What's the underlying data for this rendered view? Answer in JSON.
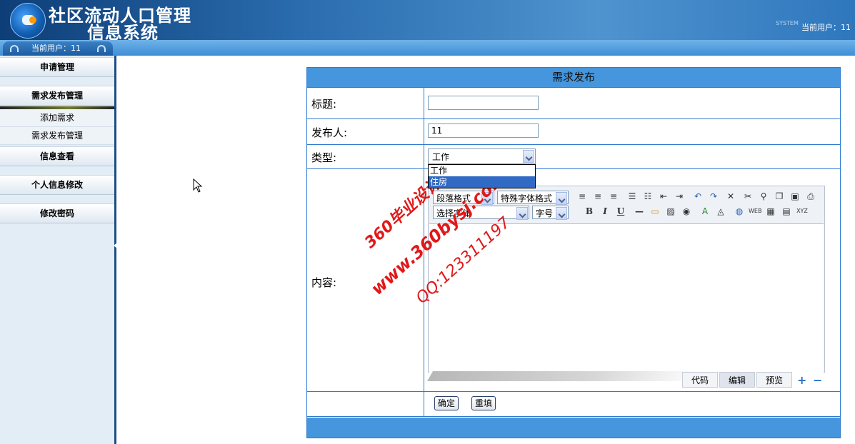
{
  "header": {
    "title_line1": "社区流动人口管理",
    "title_line2": "信息系统",
    "system_mark": "SYSTEM",
    "current_user_label": "当前用户：11"
  },
  "subbar": {
    "current_user_label": "当前用户：11"
  },
  "sidebar": {
    "menu_apply": "申请管理",
    "menu_demand": "需求发布管理",
    "sub_add": "添加需求",
    "sub_manage": "需求发布管理",
    "menu_info": "信息查看",
    "menu_profile": "个人信息修改",
    "menu_password": "修改密码"
  },
  "form": {
    "header": "需求发布",
    "title_label": "标题:",
    "title_value": "",
    "publisher_label": "发布人:",
    "publisher_value": "11",
    "type_label": "类型:",
    "type_selected": "工作",
    "type_options": [
      "工作",
      "住房"
    ],
    "content_label": "内容:",
    "confirm_button": "确定",
    "reset_button": "重填"
  },
  "editor": {
    "paragraph_format": "段落格式",
    "special_format": "特殊字体格式",
    "font_select": "选择字体",
    "font_size": "字号",
    "bold": "B",
    "italic": "I",
    "underline": "U",
    "mode_tabs": [
      "代码",
      "编辑",
      "预览"
    ]
  },
  "watermark": {
    "line1": "360毕业设计网",
    "line2": "www.360bysj.com",
    "line3": "QQ:123311197"
  },
  "colors": {
    "accent": "#4596dd",
    "border": "#2f7ad0",
    "watermark": "#e21818"
  }
}
